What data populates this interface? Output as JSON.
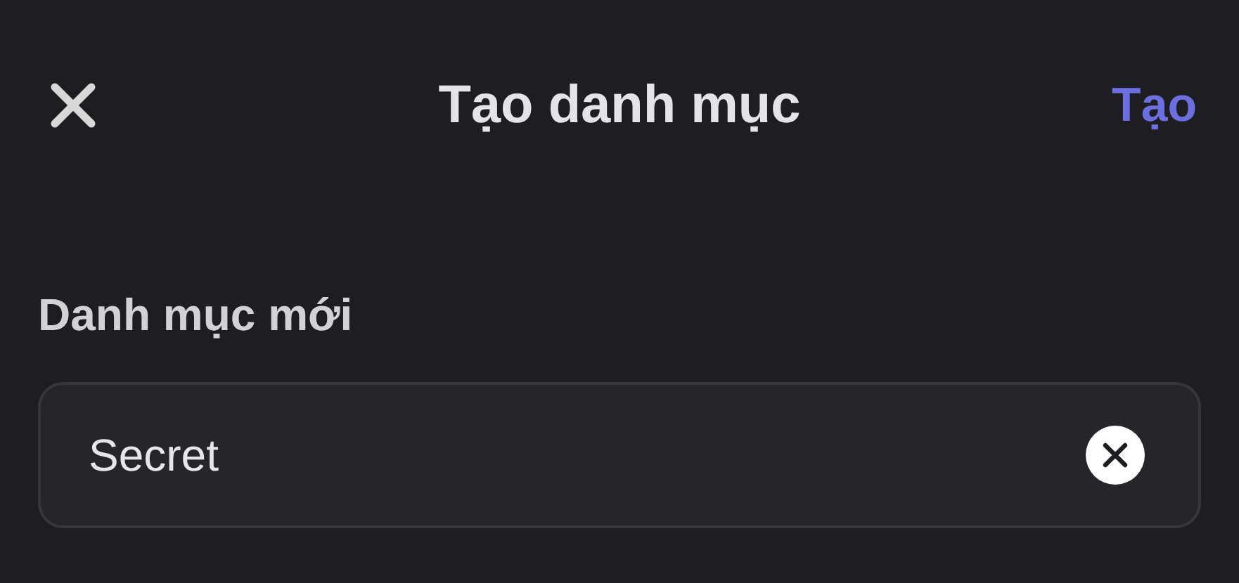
{
  "header": {
    "title": "Tạo danh mục",
    "action": "Tạo"
  },
  "field": {
    "label": "Danh mục mới",
    "value": "Secret"
  }
}
